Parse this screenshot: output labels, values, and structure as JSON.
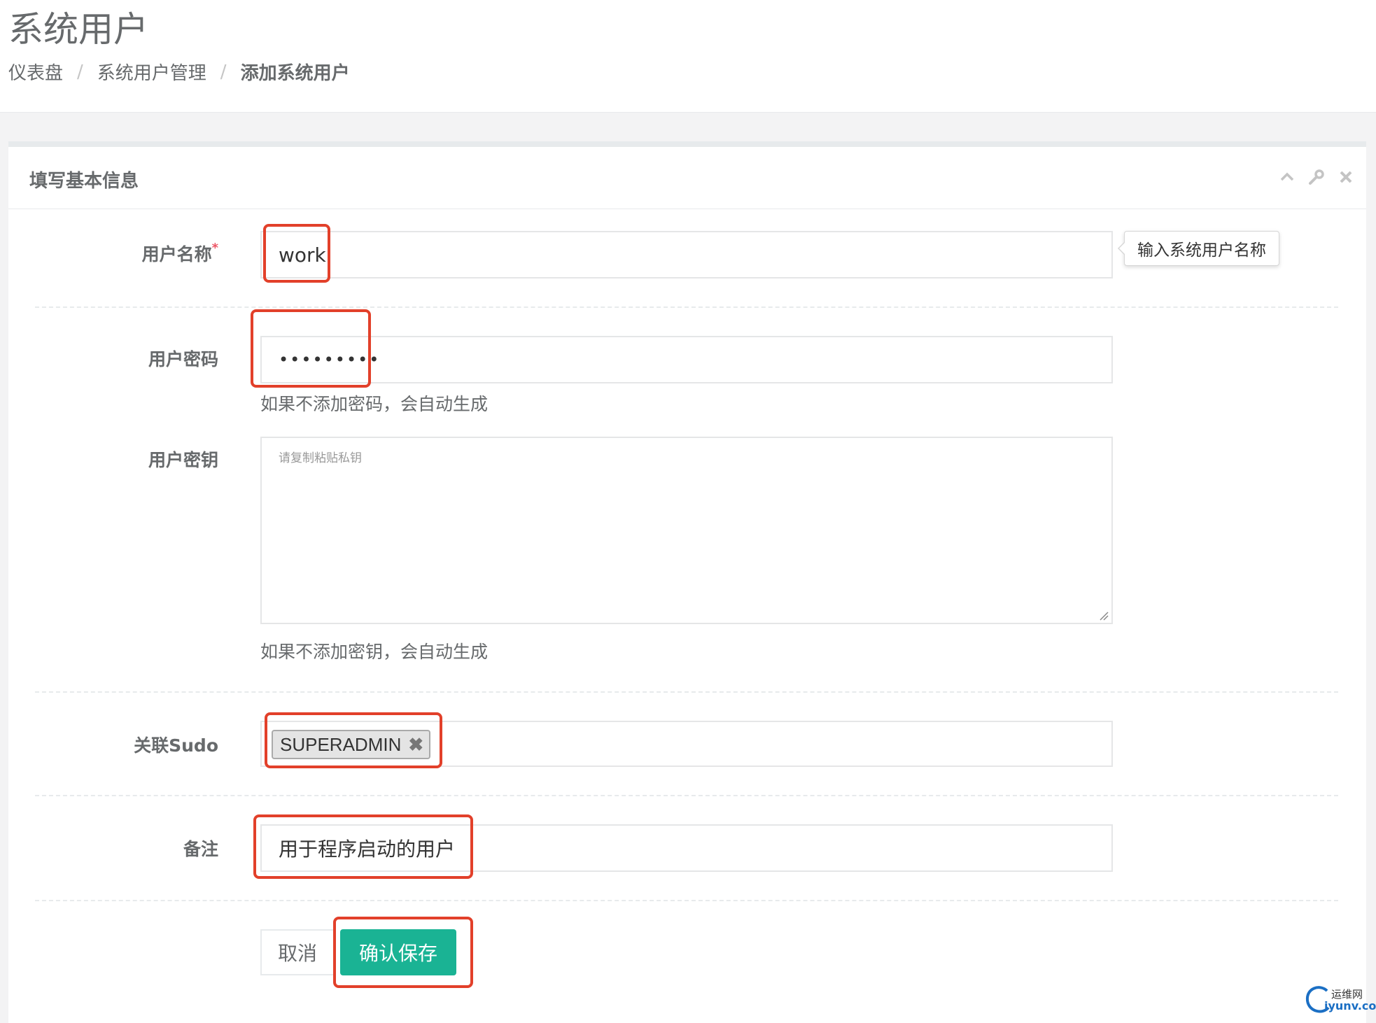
{
  "header": {
    "title": "系统用户",
    "breadcrumb": [
      "仪表盘",
      "系统用户管理",
      "添加系统用户"
    ],
    "separator": "/"
  },
  "panel": {
    "title": "填写基本信息",
    "tools": [
      "chevron-up-icon",
      "wrench-icon",
      "close-icon"
    ]
  },
  "form": {
    "username": {
      "label": "用户名称",
      "required_mark": "*",
      "value": "work",
      "tooltip": "输入系统用户名称"
    },
    "password": {
      "label": "用户密码",
      "value": "•••••••••",
      "help": "如果不添加密码，会自动生成"
    },
    "private_key": {
      "label": "用户密钥",
      "placeholder": "请复制粘贴私钥",
      "help": "如果不添加密钥，会自动生成"
    },
    "sudo": {
      "label": "关联Sudo",
      "tags": [
        "SUPERADMIN"
      ],
      "remove_glyph": "✖"
    },
    "comment": {
      "label": "备注",
      "value": "用于程序启动的用户"
    }
  },
  "actions": {
    "cancel_label": "取消",
    "save_label": "确认保存"
  },
  "watermark": {
    "line1": "运维网",
    "line2": "iyunv.com"
  },
  "colors": {
    "accent": "#1ab394",
    "highlight": "#e2402a",
    "required": "#ed5565"
  }
}
